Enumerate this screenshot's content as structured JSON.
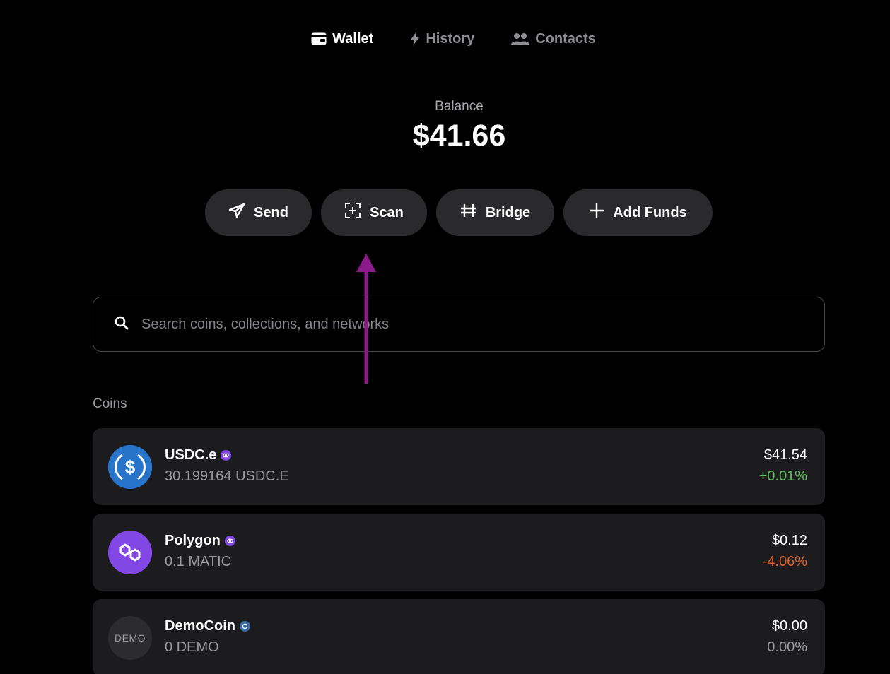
{
  "nav": {
    "tabs": [
      {
        "label": "Wallet",
        "icon": "wallet-icon",
        "active": true
      },
      {
        "label": "History",
        "icon": "lightning-icon",
        "active": false
      },
      {
        "label": "Contacts",
        "icon": "people-icon",
        "active": false
      }
    ]
  },
  "balance": {
    "label": "Balance",
    "value": "$41.66"
  },
  "actions": [
    {
      "label": "Send",
      "icon": "send-icon"
    },
    {
      "label": "Scan",
      "icon": "scan-icon"
    },
    {
      "label": "Bridge",
      "icon": "bridge-icon"
    },
    {
      "label": "Add Funds",
      "icon": "plus-icon"
    }
  ],
  "search": {
    "placeholder": "Search coins, collections, and networks",
    "value": ""
  },
  "coins_section": {
    "title": "Coins",
    "items": [
      {
        "name": "USDC.e",
        "amount": "30.199164 USDC.E",
        "value": "$41.54",
        "change": "+0.01%",
        "change_color": "#5ac35a",
        "icon": "usdc-icon",
        "icon_color": "#2775ca",
        "badge": "polygon-chain-icon",
        "badge_color": "#8247e5"
      },
      {
        "name": "Polygon",
        "amount": "0.1 MATIC",
        "value": "$0.12",
        "change": "-4.06%",
        "change_color": "#e0642a",
        "icon": "polygon-icon",
        "icon_color": "#8247e5",
        "badge": "polygon-chain-icon",
        "badge_color": "#8247e5"
      },
      {
        "name": "DemoCoin",
        "amount": "0 DEMO",
        "value": "$0.00",
        "change": "0.00%",
        "change_color": "#9a9a9f",
        "icon": "democoin-icon",
        "icon_text": "DEMO",
        "icon_color": "#2c2c2e",
        "badge": "network-chain-icon",
        "badge_color": "#3a6ea5"
      }
    ]
  },
  "annotation": {
    "arrow_color": "#8a1a8a",
    "arrow_icon": "up-arrow-annotation-icon"
  }
}
